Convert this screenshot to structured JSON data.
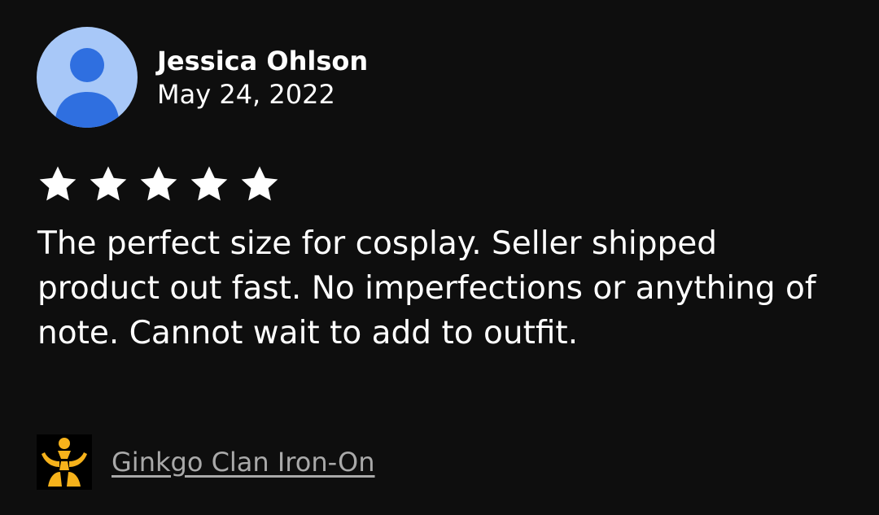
{
  "review": {
    "reviewer_name": "Jessica Ohlson",
    "date": "May 24, 2022",
    "rating": 5,
    "rating_max": 5,
    "text": "The perfect size for cosplay. Seller shipped product out fast. No imperfections or anything of note. Cannot wait to add to outfit.",
    "product_link": "Ginkgo Clan Iron-On"
  },
  "icons": {
    "avatar": "default-user-avatar-icon",
    "star": "star-filled-icon",
    "product": "ginkgo-clan-emblem-icon"
  },
  "colors": {
    "background": "#0e0e0e",
    "text": "#ffffff",
    "avatar_bg": "#a8c8f8",
    "avatar_figure": "#2f6fe0",
    "link": "#a9a9a9",
    "emblem": "#f6b21b"
  }
}
